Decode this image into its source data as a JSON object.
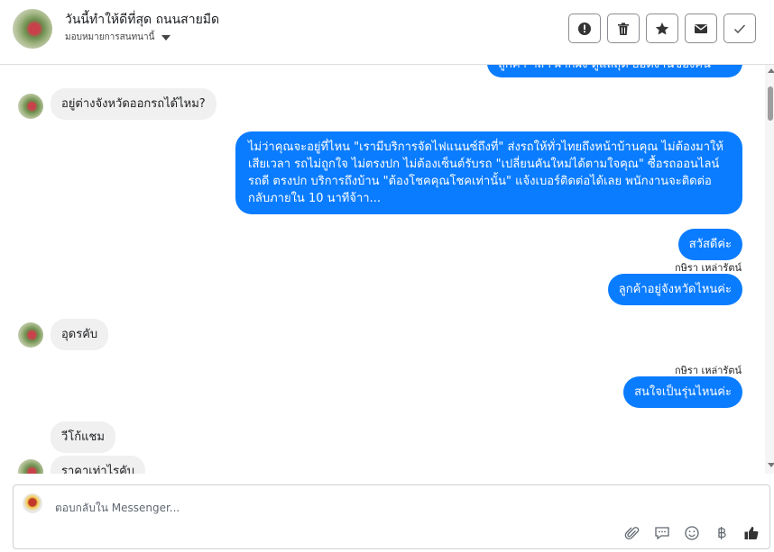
{
  "header": {
    "title": "วันนี้ทำให้ดีที่สุด ถนนสายมืด",
    "subtitle": "มอบหมายการสนทนานี้",
    "actions": [
      {
        "name": "alert-button",
        "icon": "exclamation-icon"
      },
      {
        "name": "delete-button",
        "icon": "trash-icon"
      },
      {
        "name": "star-button",
        "icon": "star-icon"
      },
      {
        "name": "mail-button",
        "icon": "envelope-icon"
      },
      {
        "name": "done-button",
        "icon": "check-icon"
      }
    ]
  },
  "messages": {
    "m0": "ลูกค้า ฯลฯ ฝากฝัง ดูแลสุด ยอดงานของคน",
    "m1": "อยู่ต่างจังหวัดออกรถได้ไหม?",
    "m2": "ไม่ว่าคุณจะอยู่ที่ไหน \"เรามีบริการจัดไฟแนนซ์ถึงที่\"  ส่งรถให้ทั่วไทยถึงหน้าบ้านคุณ ไม่ต้องมาให้เสียเวลา รถไม่ถูกใจ ไม่ตรงปก ไม่ต้องเซ็นต์รับรถ \"เปลี่ยนคันใหม่ได้ตามใจคุณ\" ซื้อรถออนไลน์ รถดี ตรงปก บริการถึงบ้าน \"ต้องโชคคุณโชคเท่านั้น\" แจ้งเบอร์ติดต่อได้เลย พนักงานจะติดต่อกลับภายใน 10 นาทีจ้าา...",
    "m3": "สวัสดีค่ะ",
    "sender1": "กษิรา เหล่ารัตน์",
    "m4": "ลูกค้าอยู่จังหวัดไหนค่ะ",
    "m5": "อุดรคับ",
    "sender2": "กษิรา เหล่ารัตน์",
    "m6": "สนใจเป็นรุ่นไหนค่ะ",
    "m7": "วีโก้แชม",
    "m8": "ราคาเท่าไรคับ"
  },
  "composer": {
    "placeholder": "ตอบกลับใน Messenger...",
    "tools": [
      "paperclip-icon",
      "speech-bubble-icon",
      "smiley-icon",
      "baht-icon",
      "thumbs-up-icon"
    ]
  },
  "colors": {
    "outgoing": "#0a7cff",
    "incoming": "#f0f0f0"
  }
}
